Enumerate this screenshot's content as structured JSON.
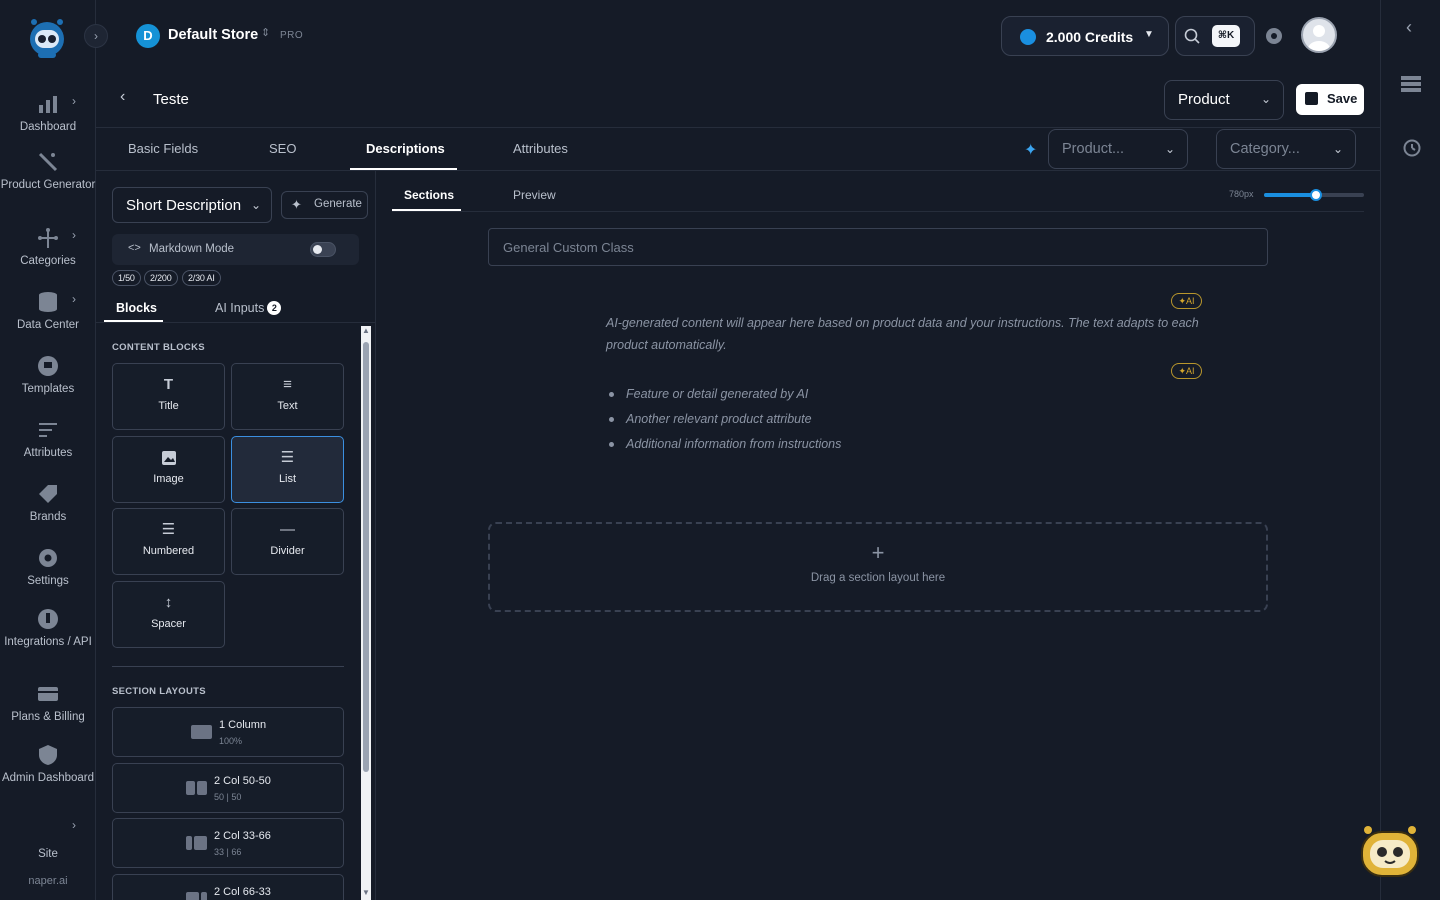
{
  "sidebar": {
    "items": [
      {
        "label": "Dashboard",
        "icon": "bar-chart-icon",
        "chevron": true
      },
      {
        "label": "Product Generator",
        "icon": "magic-wand-icon",
        "chevron": false
      },
      {
        "label": "Categories",
        "icon": "tree-icon",
        "chevron": true
      },
      {
        "label": "Data Center",
        "icon": "database-icon",
        "chevron": true
      },
      {
        "label": "Templates",
        "icon": "template-icon",
        "chevron": false
      },
      {
        "label": "Attributes",
        "icon": "list-icon",
        "chevron": false
      },
      {
        "label": "Brands",
        "icon": "tag-icon",
        "chevron": false
      },
      {
        "label": "Settings",
        "icon": "gear-icon",
        "chevron": false
      },
      {
        "label": "Integrations / API",
        "icon": "plug-icon",
        "chevron": false
      },
      {
        "label": "Plans & Billing",
        "icon": "card-icon",
        "chevron": false
      },
      {
        "label": "Admin Dashboard",
        "icon": "shield-icon",
        "chevron": false
      }
    ],
    "site_label": "Site",
    "footer": "naper.ai"
  },
  "topbar": {
    "store_initial": "D",
    "store_name": "Default Store",
    "plan": "PRO",
    "credits": "2.000 Credits",
    "shortcut": "⌘K"
  },
  "header": {
    "title": "Teste",
    "product_select": "Product",
    "save_label": "Save"
  },
  "tabs": [
    "Basic Fields",
    "SEO",
    "Descriptions",
    "Attributes"
  ],
  "filters": {
    "product_placeholder": "Product...",
    "category_placeholder": "Category..."
  },
  "panel": {
    "description_type": "Short Description",
    "generate_label": "Generate",
    "markdown_label": "Markdown Mode",
    "markdown_enabled": false,
    "chips": [
      "1/50",
      "2/200",
      "2/30 AI"
    ],
    "subtabs": {
      "blocks": "Blocks",
      "ai_inputs": "AI Inputs",
      "ai_inputs_count": "2"
    },
    "content_blocks_title": "CONTENT BLOCKS",
    "blocks": [
      {
        "label": "Title",
        "icon": "title-icon"
      },
      {
        "label": "Text",
        "icon": "text-icon"
      },
      {
        "label": "Image",
        "icon": "image-icon"
      },
      {
        "label": "List",
        "icon": "list-icon"
      },
      {
        "label": "Numbered",
        "icon": "numbered-list-icon"
      },
      {
        "label": "Divider",
        "icon": "divider-icon"
      },
      {
        "label": "Spacer",
        "icon": "spacer-icon"
      }
    ],
    "section_layouts_title": "SECTION LAYOUTS",
    "layouts": [
      {
        "name": "1 Column",
        "split": "100%"
      },
      {
        "name": "2 Col 50-50",
        "split": "50 | 50"
      },
      {
        "name": "2 Col 33-66",
        "split": "33 | 66"
      },
      {
        "name": "2 Col 66-33",
        "split": ""
      }
    ]
  },
  "canvas": {
    "tabs": [
      "Sections",
      "Preview"
    ],
    "width_label": "780px",
    "width_slider_fraction": 0.52,
    "custom_class_placeholder": "General Custom Class",
    "ai_tag": "AI",
    "ai_paragraph": "AI-generated content will appear here based on product data and your instructions. The text adapts to each product automatically.",
    "ai_list": [
      "Feature or detail generated by AI",
      "Another relevant product attribute",
      "Additional information from instructions"
    ],
    "dropzone_text": "Drag a section layout here"
  },
  "colors": {
    "background": "#151b27",
    "accent": "#1a8fe0",
    "ai_tag": "#d4a72c"
  }
}
